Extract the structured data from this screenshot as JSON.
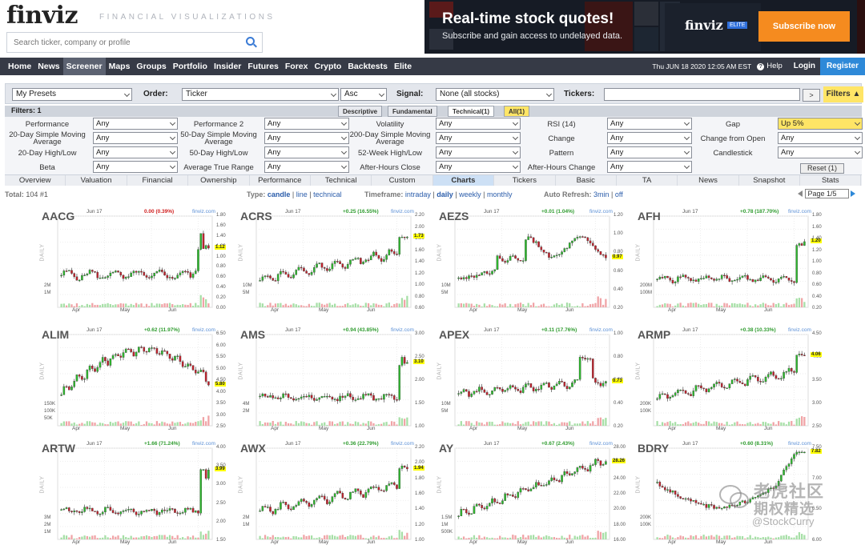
{
  "header": {
    "logo": "finviz",
    "tagline": "FINANCIAL VISUALIZATIONS",
    "search_placeholder": "Search ticker, company or profile"
  },
  "ad": {
    "headline": "Real-time stock quotes!",
    "subtext": "Subscribe and gain access to undelayed data.",
    "logo": "finviz",
    "badge": "ELITE",
    "button": "Subscribe now",
    "button_color": "#f58b1f"
  },
  "nav": {
    "items": [
      "Home",
      "News",
      "Screener",
      "Maps",
      "Groups",
      "Portfolio",
      "Insider",
      "Futures",
      "Forex",
      "Crypto",
      "Backtests",
      "Elite"
    ],
    "active": "Screener",
    "datetime": "Thu JUN 18 2020 12:05 AM EST",
    "help": "Help",
    "login": "Login",
    "register": "Register"
  },
  "screener": {
    "presets": "My Presets",
    "order_label": "Order:",
    "order_value": "Ticker",
    "order_dir": "Asc",
    "signal_label": "Signal:",
    "signal_value": "None (all stocks)",
    "tickers_label": "Tickers:",
    "tickers_value": "",
    "go": ">",
    "filters_button": "Filters"
  },
  "filter_tabs": {
    "count_label": "Filters: 1",
    "tabs": [
      "Descriptive",
      "Fundamental",
      "Technical(1)",
      "All(1)"
    ]
  },
  "filters": [
    [
      [
        "Performance",
        "Any"
      ],
      [
        "Performance 2",
        "Any"
      ],
      [
        "Volatility",
        "Any"
      ],
      [
        "RSI (14)",
        "Any"
      ],
      [
        "Gap",
        "Up 5%"
      ]
    ],
    [
      [
        "20-Day Simple Moving Average",
        "Any"
      ],
      [
        "50-Day Simple Moving Average",
        "Any"
      ],
      [
        "200-Day Simple Moving Average",
        "Any"
      ],
      [
        "Change",
        "Any"
      ],
      [
        "Change from Open",
        "Any"
      ]
    ],
    [
      [
        "20-Day High/Low",
        "Any"
      ],
      [
        "50-Day High/Low",
        "Any"
      ],
      [
        "52-Week High/Low",
        "Any"
      ],
      [
        "Pattern",
        "Any"
      ],
      [
        "Candlestick",
        "Any"
      ]
    ],
    [
      [
        "Beta",
        "Any"
      ],
      [
        "Average True Range",
        "Any"
      ],
      [
        "After-Hours Close",
        "Any"
      ],
      [
        "After-Hours Change",
        "Any"
      ]
    ]
  ],
  "reset_label": "Reset (1)",
  "view_tabs": [
    "Overview",
    "Valuation",
    "Financial",
    "Ownership",
    "Performance",
    "Technical",
    "Custom",
    "Charts",
    "Tickers",
    "Basic",
    "TA",
    "News",
    "Snapshot",
    "Stats"
  ],
  "active_view": "Charts",
  "results": {
    "total_label": "Total:",
    "total_value": "104 #1",
    "type_label": "Type:",
    "type_options": [
      "candle",
      "line",
      "technical"
    ],
    "type_selected": "candle",
    "timeframe_label": "Timeframe:",
    "timeframe_options": [
      "intraday",
      "daily",
      "weekly",
      "monthly"
    ],
    "timeframe_selected": "daily",
    "refresh_label": "Auto Refresh:",
    "refresh_options": [
      "3min",
      "off"
    ],
    "page": "Page 1/5"
  },
  "charts": [
    {
      "ticker": "AACG",
      "date": "Jun 17",
      "change": "0.00 (0.39%)",
      "dir": "down",
      "last": "1.12",
      "ticks": [
        "1.80",
        "1.60",
        "1.40",
        "1.20",
        "1.00",
        "0.80",
        "0.60",
        "0.40",
        "0.20",
        "0.00"
      ],
      "vol": [
        "2M",
        "1M"
      ],
      "pattern": "flat-spike"
    },
    {
      "ticker": "ACRS",
      "date": "Jun 17",
      "change": "+0.25 (16.55%)",
      "dir": "up",
      "last": "1.73",
      "ticks": [
        "2.20",
        "2.00",
        "1.80",
        "1.60",
        "1.40",
        "1.20",
        "1.00",
        "0.80",
        "0.60"
      ],
      "vol": [
        "10M",
        "5M"
      ],
      "pattern": "rise-spike"
    },
    {
      "ticker": "AEZS",
      "date": "Jun 17",
      "change": "+0.01 (1.04%)",
      "dir": "up",
      "last": "0.97",
      "ticks": [
        "1.20",
        "1.00",
        "0.80",
        "0.60",
        "0.40",
        "0.20"
      ],
      "vol": [
        "10M",
        "5M"
      ],
      "pattern": "step-up"
    },
    {
      "ticker": "AFH",
      "date": "Jun 17",
      "change": "+0.78 (187.70%)",
      "dir": "up",
      "last": "1.20",
      "ticks": [
        "1.80",
        "1.60",
        "1.40",
        "1.20",
        "1.00",
        "0.80",
        "0.60",
        "0.40",
        "0.20"
      ],
      "vol": [
        "200M",
        "100M"
      ],
      "pattern": "flat-jump"
    },
    {
      "ticker": "ALIM",
      "date": "Jun 17",
      "change": "+0.62 (11.97%)",
      "dir": "up",
      "last": "5.80",
      "ticks": [
        "6.50",
        "6.00",
        "5.50",
        "5.00",
        "4.50",
        "4.00",
        "3.50",
        "3.00",
        "2.50"
      ],
      "vol": [
        "150K",
        "100K",
        "50K"
      ],
      "pattern": "hump"
    },
    {
      "ticker": "AMS",
      "date": "Jun 17",
      "change": "+0.94 (43.85%)",
      "dir": "up",
      "last": "3.10",
      "ticks": [
        "3.00",
        "2.50",
        "2.00",
        "1.50",
        "1.00"
      ],
      "vol": [
        "4M",
        "2M"
      ],
      "pattern": "flat-jump"
    },
    {
      "ticker": "APEX",
      "date": "Jun 17",
      "change": "+0.11 (17.76%)",
      "dir": "up",
      "last": "0.73",
      "ticks": [
        "1.00",
        "0.80",
        "0.60",
        "0.40",
        "0.20"
      ],
      "vol": [
        "10M",
        "5M"
      ],
      "pattern": "spike-late"
    },
    {
      "ticker": "ARMP",
      "date": "Jun 17",
      "change": "+0.38 (10.33%)",
      "dir": "up",
      "last": "4.06",
      "ticks": [
        "4.50",
        "4.00",
        "3.50",
        "3.00",
        "2.50"
      ],
      "vol": [
        "200K",
        "100K"
      ],
      "pattern": "rise-spike"
    },
    {
      "ticker": "ARTW",
      "date": "Jun 17",
      "change": "+1.66 (71.24%)",
      "dir": "up",
      "last": "3.99",
      "ticks": [
        "4.00",
        "3.50",
        "3.00",
        "2.50",
        "2.00",
        "1.50"
      ],
      "vol": [
        "3M",
        "2M",
        "1M"
      ],
      "pattern": "flat-jump"
    },
    {
      "ticker": "AWX",
      "date": "Jun 17",
      "change": "+0.36 (22.79%)",
      "dir": "up",
      "last": "1.94",
      "ticks": [
        "2.20",
        "2.00",
        "1.80",
        "1.60",
        "1.40",
        "1.20",
        "1.00"
      ],
      "vol": [
        "2M",
        "1M"
      ],
      "pattern": "rise-spike"
    },
    {
      "ticker": "AY",
      "date": "Jun 17",
      "change": "+0.67 (2.43%)",
      "dir": "up",
      "last": "28.26",
      "ticks": [
        "28.00",
        "26.00",
        "24.00",
        "22.00",
        "20.00",
        "18.00",
        "16.00"
      ],
      "vol": [
        "1.5M",
        "1M",
        "500K"
      ],
      "pattern": "steady-up"
    },
    {
      "ticker": "BDRY",
      "date": "Jun 17",
      "change": "+0.60 (8.31%)",
      "dir": "up",
      "last": "7.82",
      "ticks": [
        "7.50",
        "7.00",
        "6.50",
        "6.00"
      ],
      "vol": [
        "200K",
        "100K"
      ],
      "pattern": "dip-up"
    }
  ],
  "months": [
    "Apr",
    "May",
    "Jun"
  ],
  "chart_logo": "finviz.com",
  "chart_axis_label": "DAILY",
  "watermark": {
    "line1": "老虎社区",
    "line2": "期权精选",
    "handle": "@StockCurry"
  }
}
